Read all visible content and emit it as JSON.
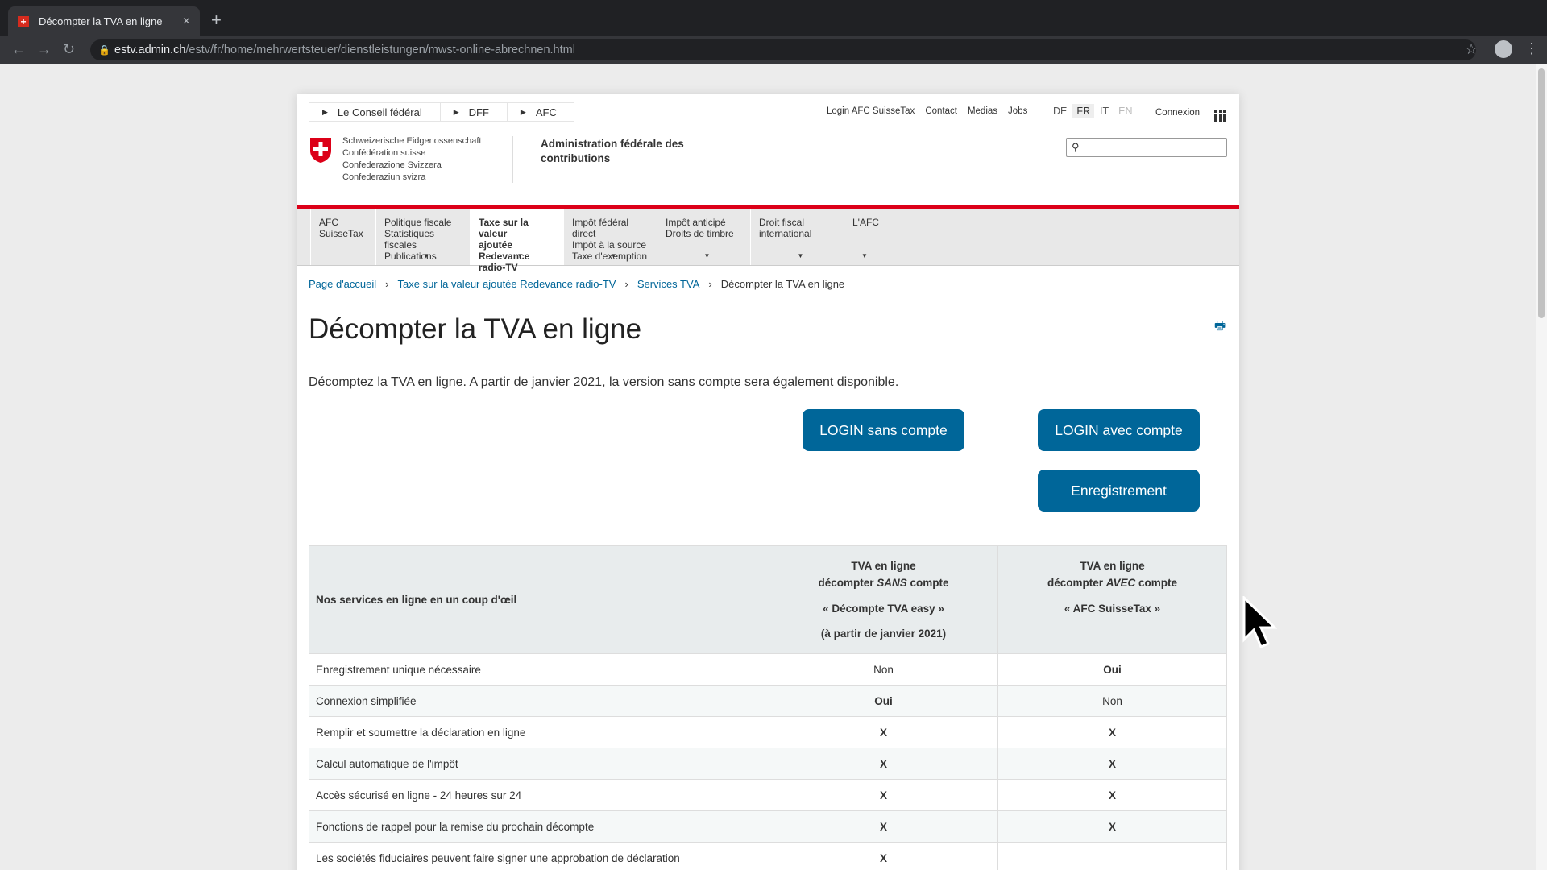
{
  "browser": {
    "tab_title": "Décompter la TVA en ligne",
    "tab_favicon": "+",
    "tab_close": "×",
    "new_tab": "+",
    "url_host": "estv.admin.ch",
    "url_path": "/estv/fr/home/mehrwertsteuer/dienstleistungen/mwst-online-abrechnen.html"
  },
  "federal_bar": [
    "Le Conseil fédéral",
    "DFF",
    "AFC"
  ],
  "top_links": [
    "Login AFC SuisseTax",
    "Contact",
    "Medias",
    "Jobs"
  ],
  "languages": [
    {
      "code": "DE",
      "state": "normal"
    },
    {
      "code": "FR",
      "state": "active"
    },
    {
      "code": "IT",
      "state": "normal"
    },
    {
      "code": "EN",
      "state": "disabled"
    }
  ],
  "connexion": "Connexion",
  "confederation_names": [
    "Schweizerische Eidgenossenschaft",
    "Confédération suisse",
    "Confederazione Svizzera",
    "Confederaziun svizra"
  ],
  "admin_name": "Administration fédérale des contributions",
  "main_nav": [
    {
      "lines": [
        "AFC SuisseTax"
      ],
      "caret": false,
      "active": false
    },
    {
      "lines": [
        "Politique fiscale",
        "Statistiques fiscales",
        "Publications"
      ],
      "caret": true,
      "active": false
    },
    {
      "lines": [
        "Taxe sur la valeur",
        "ajoutée",
        "Redevance radio-TV"
      ],
      "caret": true,
      "active": true
    },
    {
      "lines": [
        "Impôt fédéral direct",
        "Impôt à la source",
        "Taxe d'exemption"
      ],
      "caret": true,
      "active": false
    },
    {
      "lines": [
        "Impôt anticipé",
        "Droits de timbre"
      ],
      "caret": true,
      "active": false
    },
    {
      "lines": [
        "Droit fiscal",
        "international"
      ],
      "caret": true,
      "active": false
    },
    {
      "lines": [
        "L'AFC"
      ],
      "caret": true,
      "active": false
    }
  ],
  "breadcrumb": [
    {
      "label": "Page d'accueil",
      "link": true
    },
    {
      "label": "Taxe sur la valeur ajoutée Redevance radio-TV",
      "link": true
    },
    {
      "label": "Services TVA",
      "link": true
    },
    {
      "label": "Décompter la TVA en ligne",
      "link": false
    }
  ],
  "title": "Décompter la TVA en ligne",
  "intro": "Décomptez la TVA en ligne. A partir de janvier 2021, la version sans compte sera également disponible.",
  "buttons": {
    "login_without": "LOGIN sans compte",
    "login_with": "LOGIN avec compte",
    "register": "Enregistrement"
  },
  "table": {
    "header_label": "Nos services en ligne en un coup d'œil",
    "col1": {
      "l1": "TVA en ligne",
      "l2a": "décompter ",
      "l2i": "SANS",
      "l2b": " compte",
      "l3": "« Décompte TVA easy »",
      "l4": "(à partir de janvier 2021)"
    },
    "col2": {
      "l1": "TVA en ligne",
      "l2a": "décompter ",
      "l2i": "AVEC",
      "l2b": " compte",
      "l3": "« AFC SuisseTax »"
    },
    "rows": [
      {
        "label": "Enregistrement unique nécessaire",
        "a": "Non",
        "b": "Oui",
        "bold_a": false,
        "bold_b": true
      },
      {
        "label": "Connexion simplifiée",
        "a": "Oui",
        "b": "Non",
        "bold_a": true,
        "bold_b": false
      },
      {
        "label": "Remplir et soumettre la déclaration en ligne",
        "a": "X",
        "b": "X",
        "bold_a": true,
        "bold_b": true
      },
      {
        "label": "Calcul automatique de l'impôt",
        "a": "X",
        "b": "X",
        "bold_a": true,
        "bold_b": true
      },
      {
        "label": "Accès sécurisé en ligne - 24 heures sur 24",
        "a": "X",
        "b": "X",
        "bold_a": true,
        "bold_b": true
      },
      {
        "label": "Fonctions de rappel pour la remise du prochain décompte",
        "a": "X",
        "b": "X",
        "bold_a": true,
        "bold_b": true
      },
      {
        "label": "Les sociétés fiduciaires peuvent faire signer une approbation de déclaration",
        "a": "X",
        "b": "",
        "bold_a": true,
        "bold_b": false
      }
    ]
  },
  "icons": {
    "print": "print-icon",
    "search": "search-icon",
    "apps": "apps-grid-icon",
    "swiss_cross": "swiss-cross-icon"
  },
  "colors": {
    "brand_red": "#dc0018",
    "link_blue": "#006699",
    "button_blue": "#006699"
  }
}
